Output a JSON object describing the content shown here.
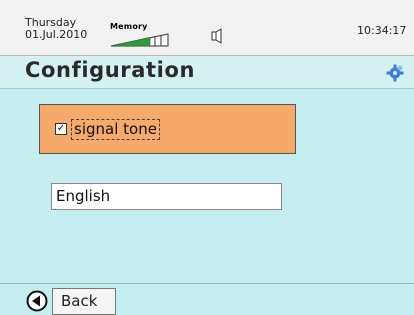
{
  "status_bar": {
    "day": "Thursday",
    "date": "01.Jul.2010",
    "memory_label": "Memory",
    "time": "10:34:17"
  },
  "header": {
    "title": "Configuration",
    "icon": "gear-icon"
  },
  "settings": {
    "signal_tone_label": "signal tone",
    "signal_tone_checked": true,
    "checkbox_mark": "✓",
    "language_value": "English"
  },
  "footer": {
    "back_label": "Back"
  },
  "colors": {
    "background": "#c6eef0",
    "status_bar": "#f2f2f2",
    "panel": "#f5a96b",
    "memory_fill": "#2f9b3a",
    "gear": "#3d7fd6"
  }
}
